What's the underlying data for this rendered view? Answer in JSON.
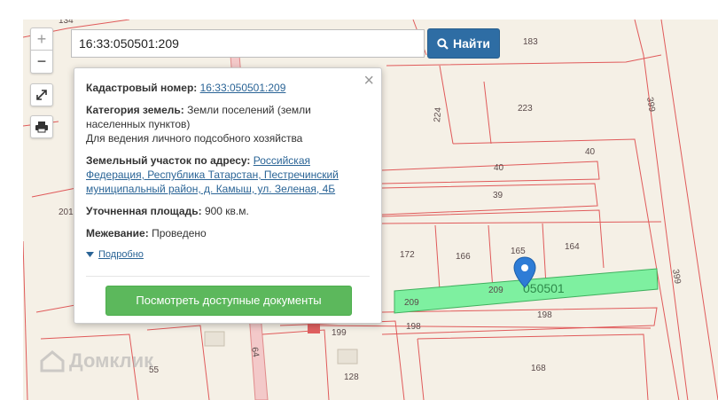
{
  "map": {
    "parcel_labels": {
      "l134": "134",
      "l183": "183",
      "l399a": "399",
      "l399b": "399",
      "l223": "223",
      "l224": "224",
      "l40a": "40",
      "l40b": "40",
      "l39": "39",
      "l172": "172",
      "l166": "166",
      "l165": "165",
      "l164": "164",
      "l209a": "209",
      "l209b": "209",
      "l198a": "198",
      "l198b": "198",
      "l199": "199",
      "l168": "168",
      "l128": "128",
      "l55": "55",
      "l201": "201",
      "l64": "64"
    },
    "quarter_label": "050501",
    "highlight_color": "#7ef0a0"
  },
  "controls": {
    "zoom_in": "+",
    "zoom_out": "−"
  },
  "search": {
    "value": "16:33:050501:209",
    "button_label": "Найти"
  },
  "popup": {
    "cadastral_label": "Кадастровый номер:",
    "cadastral_value": "16:33:050501:209",
    "category_label": "Категория земель:",
    "category_value": "Земли поселений (земли населенных пунктов)",
    "usage": "Для ведения личного подсобного хозяйства",
    "address_label": "Земельный участок по адресу:",
    "address_value": "Российская Федерация, Республика Татарстан, Пестречинский муниципальный район, д. Камыш, ул. Зеленая, 4Б",
    "area_label": "Уточненная площадь:",
    "area_value": "900 кв.м.",
    "survey_label": "Межевание:",
    "survey_value": "Проведено",
    "more_label": "Подробно",
    "docs_button": "Посмотреть доступные документы"
  },
  "watermark": "Домклик"
}
